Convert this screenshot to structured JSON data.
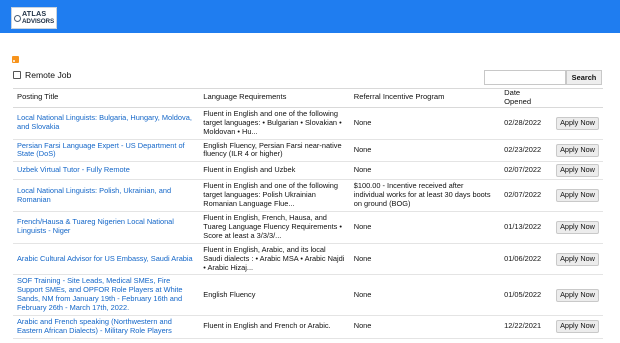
{
  "header": {
    "logo_line1": "ATLAS",
    "logo_line2": "ADVISORS",
    "colors": {
      "topbar": "#1f7df0",
      "link": "#1366c8",
      "rss": "#f7941d"
    }
  },
  "filters": {
    "remote_job_label": "Remote Job",
    "remote_job_checked": false,
    "search_value": "",
    "search_button_label": "Search"
  },
  "table": {
    "headers": [
      "Posting Title",
      "Language Requirements",
      "Referral Incentive Program",
      "Date Opened",
      ""
    ],
    "rows": [
      {
        "title": "Local National Linguists: Bulgaria, Hungary, Moldova, and Slovakia",
        "language": "Fluent in English and one of the following target languages: • Bulgarian • Slovakian • Moldovan • Hu...",
        "referral": "None",
        "date": "02/28/2022",
        "action": "Apply Now"
      },
      {
        "title": "Persian Farsi Language Expert - US Department of State (DoS)",
        "language": "English Fluency, Persian Farsi near-native fluency (ILR 4 or higher)",
        "referral": "None",
        "date": "02/23/2022",
        "action": "Apply Now"
      },
      {
        "title": "Uzbek Virtual Tutor - Fully Remote",
        "language": "Fluent in English and Uzbek",
        "referral": "None",
        "date": "02/07/2022",
        "action": "Apply Now"
      },
      {
        "title": "Local National Linguists: Polish, Ukrainian, and Romanian",
        "language": "Fluent in English and one of the following target languages: Polish Ukrainian Romanian Language Flue...",
        "referral": "$100.00 - Incentive received after individual works for at least 30 days boots on ground (BOG)",
        "date": "02/07/2022",
        "action": "Apply Now"
      },
      {
        "title": "French/Hausa & Tuareg Nigerien Local National Linguists - Niger",
        "language": "Fluent in English, French, Hausa, and Tuareg Language Fluency Requirements • Score at least a 3/3/3/...",
        "referral": "None",
        "date": "01/13/2022",
        "action": "Apply Now"
      },
      {
        "title": "Arabic Cultural Advisor for US Embassy, Saudi Arabia",
        "language": "Fluent in English, Arabic, and its local Saudi dialects : • Arabic MSA • Arabic Najdi • Arabic Hizaj...",
        "referral": "None",
        "date": "01/06/2022",
        "action": "Apply Now"
      },
      {
        "title": "SOF Training - Site Leads, Medical SMEs, Fire Support SMEs, and OPFOR Role Players at White Sands, NM from January 19th - February 16th and February 26th - March 17th, 2022.",
        "language": "English Fluency",
        "referral": "None",
        "date": "01/05/2022",
        "action": "Apply Now"
      },
      {
        "title": "Arabic and French speaking (Northwestern and Eastern African Dialects) - Military Role Players",
        "language": "Fluent in English and French or Arabic.",
        "referral": "None",
        "date": "12/22/2021",
        "action": "Apply Now"
      }
    ]
  }
}
